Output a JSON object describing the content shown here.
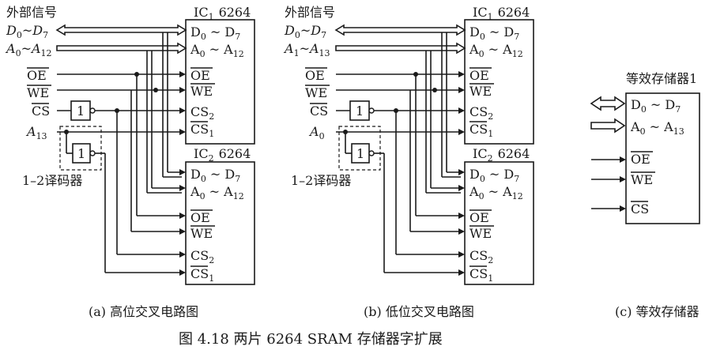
{
  "left": {
    "header": "外部信号",
    "signals": {
      "d": "D",
      "d0sub": "0",
      "d7sub": "7",
      "a": "A",
      "a0sub": "0",
      "a12sub": "12",
      "oe": "OE",
      "we": "WE",
      "cs": "CS",
      "a13": "A",
      "a13sub": "13"
    },
    "not_gate": "1",
    "decoder_gate": "1",
    "decoder_label": "1–2译码器",
    "chip1": {
      "title": "IC",
      "sub": "1",
      "model": "6264",
      "d": "D",
      "d0": "0",
      "d7": "7",
      "a": "A",
      "a0": "0",
      "a12": "12",
      "oe": "OE",
      "we": "WE",
      "cs2": "CS",
      "cs2sub": "2",
      "cs1": "CS",
      "cs1sub": "1"
    },
    "chip2": {
      "title": "IC",
      "sub": "2",
      "model": "6264",
      "d": "D",
      "d0": "0",
      "d7": "7",
      "a": "A",
      "a0": "0",
      "a12": "12",
      "oe": "OE",
      "we": "WE",
      "cs2": "CS",
      "cs2sub": "2",
      "cs1": "CS",
      "cs1sub": "1"
    },
    "caption": "(a) 高位交叉电路图"
  },
  "middle": {
    "header": "外部信号",
    "signals": {
      "d": "D",
      "d0sub": "0",
      "d7sub": "7",
      "a": "A",
      "a1sub": "1",
      "a13sub": "13",
      "oe": "OE",
      "we": "WE",
      "cs": "CS",
      "a0": "A",
      "a0sub": "0"
    },
    "not_gate": "1",
    "decoder_gate": "1",
    "decoder_label": "1–2译码器",
    "chip1": {
      "title": "IC",
      "sub": "1",
      "model": "6264",
      "d": "D",
      "d0": "0",
      "d7": "7",
      "a": "A",
      "a0": "0",
      "a12": "12",
      "oe": "OE",
      "we": "WE",
      "cs2": "CS",
      "cs2sub": "2",
      "cs1": "CS",
      "cs1sub": "1"
    },
    "chip2": {
      "title": "IC",
      "sub": "2",
      "model": "6264",
      "d": "D",
      "d0": "0",
      "d7": "7",
      "a": "A",
      "a0": "0",
      "a12": "12",
      "oe": "OE",
      "we": "WE",
      "cs2": "CS",
      "cs2sub": "2",
      "cs1": "CS",
      "cs1sub": "1"
    },
    "caption": "(b) 低位交叉电路图"
  },
  "right": {
    "title": "等效存储器1",
    "d": "D",
    "d0": "0",
    "d7": "7",
    "a": "A",
    "a0": "0",
    "a13": "13",
    "oe": "OE",
    "we": "WE",
    "cs": "CS",
    "caption": "(c) 等效存储器"
  },
  "figure_title": "图 4.18   两片 6264 SRAM 存储器字扩展"
}
